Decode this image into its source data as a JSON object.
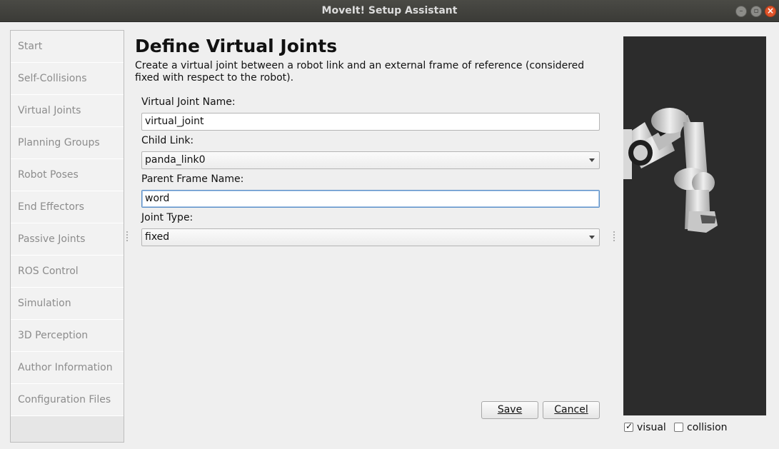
{
  "window": {
    "title": "MoveIt! Setup Assistant"
  },
  "sidebar": {
    "items": [
      "Start",
      "Self-Collisions",
      "Virtual Joints",
      "Planning Groups",
      "Robot Poses",
      "End Effectors",
      "Passive Joints",
      "ROS Control",
      "Simulation",
      "3D Perception",
      "Author Information",
      "Configuration Files"
    ]
  },
  "main": {
    "title": "Define Virtual Joints",
    "description": "Create a virtual joint between a robot link and an external frame of reference (considered fixed with respect to the robot).",
    "fields": {
      "name_label": "Virtual Joint Name:",
      "name_value": "virtual_joint",
      "child_label": "Child Link:",
      "child_value": "panda_link0",
      "parent_label": "Parent Frame Name:",
      "parent_value": "word",
      "type_label": "Joint Type:",
      "type_value": "fixed"
    },
    "save_label": "Save",
    "cancel_label": "Cancel"
  },
  "viewer": {
    "visual_label": "visual",
    "visual_checked": true,
    "collision_label": "collision",
    "collision_checked": false
  }
}
